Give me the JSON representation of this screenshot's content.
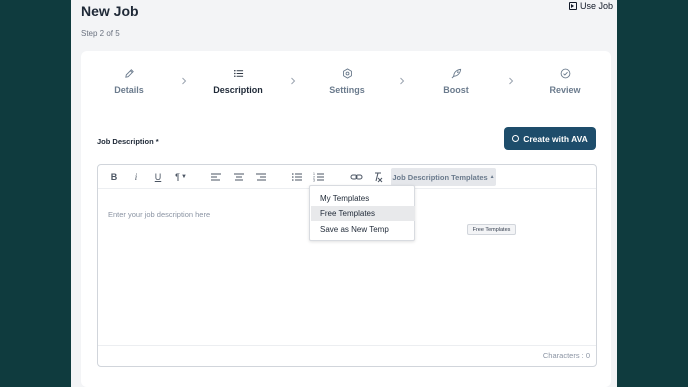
{
  "colors": {
    "background": "#0f3b3e",
    "primary": "#1e4d6b",
    "arrow": "#10a37f"
  },
  "header": {
    "title": "New Job",
    "step_text": "Step 2 of 5",
    "use_job_label": "Use Job"
  },
  "stepper": {
    "active_index": 1,
    "steps": [
      {
        "label": "Details",
        "icon": "pencil-icon"
      },
      {
        "label": "Description",
        "icon": "list-icon"
      },
      {
        "label": "Settings",
        "icon": "gear-icon"
      },
      {
        "label": "Boost",
        "icon": "rocket-icon"
      },
      {
        "label": "Review",
        "icon": "check-circle-icon"
      }
    ]
  },
  "form": {
    "job_description_label": "Job Description *",
    "create_ava_label": "Create with AVA"
  },
  "editor": {
    "toolbar": {
      "bold": "B",
      "italic": "i",
      "underline": "U",
      "paragraph": "¶",
      "templates_label": "Job Description Templates"
    },
    "placeholder": "Enter your job description here",
    "characters_label": "Characters : 0"
  },
  "templates_dropdown": {
    "items": [
      "My Templates",
      "Free Templates",
      "Save as New Temp"
    ],
    "hovered_index": 1,
    "tooltip": "Free Templates"
  }
}
